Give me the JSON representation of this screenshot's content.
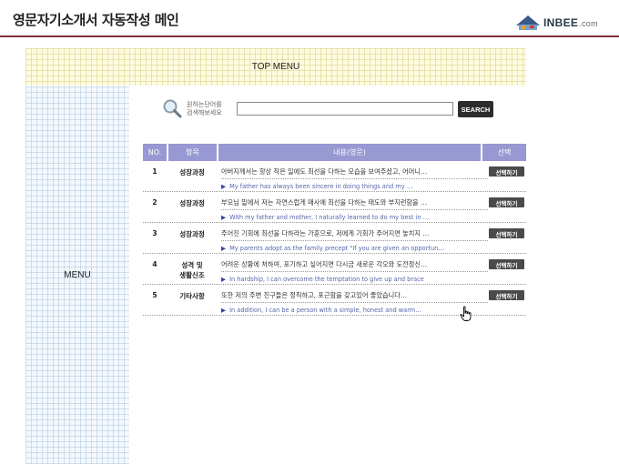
{
  "header": {
    "title": "영문자기소개서 자동작성 메인",
    "logo_text": "INBEE",
    "logo_domain": ".com"
  },
  "top_menu": {
    "label": "TOP MENU"
  },
  "left_menu": {
    "label": "MENU"
  },
  "search": {
    "hint_line1": "원하는단어를",
    "hint_line2": "검색해보세요",
    "value": "",
    "button_label": "SEARCH"
  },
  "table": {
    "columns": {
      "no": "NO.",
      "category": "항목",
      "content": "내용(영문)",
      "select": "선택"
    },
    "rows": [
      {
        "no": "1",
        "category": "성장과정",
        "category_line2": "",
        "korean": "아버지께서는 항상 작은 일에도 최선을 다하는 모습을 보여주셨고, 어머니…",
        "english": "My father  has always been sincere in doing  things  and my  …",
        "select_label": "선택하기"
      },
      {
        "no": "2",
        "category": "성장과정",
        "category_line2": "",
        "korean": "부모님 밑에서 저는 자연스럽게 매사에 최선을 다하는 태도와 부지런함을 …",
        "english": "With  my  father  and  mother,  I naturally  learned  to  do  my  best  in  …",
        "select_label": "선택하기"
      },
      {
        "no": "3",
        "category": "성장과정",
        "category_line2": "",
        "korean": "주어진 기회에 최선을 다하라는 가훈으로, 저에게 기회가 주어지면 놓치지 …",
        "english": "My parents  adopt  as the family  precept  \"If  you are given  an opportun…",
        "select_label": "선택하기"
      },
      {
        "no": "4",
        "category": "성격 및",
        "category_line2": "생활신조",
        "korean": "어려운 상황에 처하여, 포기하고 싶어지면 다시금 새로운 각오와 도전정신…",
        "english": "In hardship,  I can overcome  the temptation  to give up and brace",
        "select_label": "선택하기"
      },
      {
        "no": "5",
        "category": "기타사항",
        "category_line2": "",
        "korean": "또한 저의 주변 친구들은 정직하고, 포근함을 갖고있어 좋았습니다…",
        "english": "In addition,  I can  be a person  with a simple,  honest  and  warm…",
        "select_label": "선택하기"
      }
    ]
  },
  "colors": {
    "title_rule": "#7b2d3a",
    "table_header": "#9898d2",
    "english_text": "#5566aa",
    "button_dark": "#2c2c2c"
  },
  "icons": {
    "search": "magnifier-icon",
    "logo": "house-icon",
    "arrow": "triangle-right-icon",
    "cursor": "hand-pointer-icon"
  }
}
